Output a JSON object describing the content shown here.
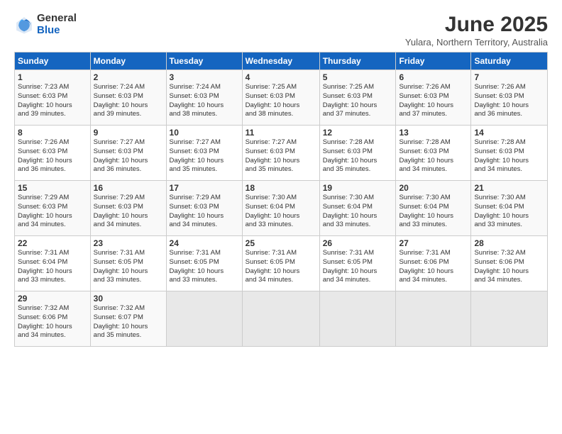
{
  "logo": {
    "general": "General",
    "blue": "Blue"
  },
  "title": "June 2025",
  "subtitle": "Yulara, Northern Territory, Australia",
  "weekdays": [
    "Sunday",
    "Monday",
    "Tuesday",
    "Wednesday",
    "Thursday",
    "Friday",
    "Saturday"
  ],
  "weeks": [
    [
      {
        "day": "1",
        "info": "Sunrise: 7:23 AM\nSunset: 6:03 PM\nDaylight: 10 hours\nand 39 minutes."
      },
      {
        "day": "2",
        "info": "Sunrise: 7:24 AM\nSunset: 6:03 PM\nDaylight: 10 hours\nand 39 minutes."
      },
      {
        "day": "3",
        "info": "Sunrise: 7:24 AM\nSunset: 6:03 PM\nDaylight: 10 hours\nand 38 minutes."
      },
      {
        "day": "4",
        "info": "Sunrise: 7:25 AM\nSunset: 6:03 PM\nDaylight: 10 hours\nand 38 minutes."
      },
      {
        "day": "5",
        "info": "Sunrise: 7:25 AM\nSunset: 6:03 PM\nDaylight: 10 hours\nand 37 minutes."
      },
      {
        "day": "6",
        "info": "Sunrise: 7:26 AM\nSunset: 6:03 PM\nDaylight: 10 hours\nand 37 minutes."
      },
      {
        "day": "7",
        "info": "Sunrise: 7:26 AM\nSunset: 6:03 PM\nDaylight: 10 hours\nand 36 minutes."
      }
    ],
    [
      {
        "day": "8",
        "info": "Sunrise: 7:26 AM\nSunset: 6:03 PM\nDaylight: 10 hours\nand 36 minutes."
      },
      {
        "day": "9",
        "info": "Sunrise: 7:27 AM\nSunset: 6:03 PM\nDaylight: 10 hours\nand 36 minutes."
      },
      {
        "day": "10",
        "info": "Sunrise: 7:27 AM\nSunset: 6:03 PM\nDaylight: 10 hours\nand 35 minutes."
      },
      {
        "day": "11",
        "info": "Sunrise: 7:27 AM\nSunset: 6:03 PM\nDaylight: 10 hours\nand 35 minutes."
      },
      {
        "day": "12",
        "info": "Sunrise: 7:28 AM\nSunset: 6:03 PM\nDaylight: 10 hours\nand 35 minutes."
      },
      {
        "day": "13",
        "info": "Sunrise: 7:28 AM\nSunset: 6:03 PM\nDaylight: 10 hours\nand 34 minutes."
      },
      {
        "day": "14",
        "info": "Sunrise: 7:28 AM\nSunset: 6:03 PM\nDaylight: 10 hours\nand 34 minutes."
      }
    ],
    [
      {
        "day": "15",
        "info": "Sunrise: 7:29 AM\nSunset: 6:03 PM\nDaylight: 10 hours\nand 34 minutes."
      },
      {
        "day": "16",
        "info": "Sunrise: 7:29 AM\nSunset: 6:03 PM\nDaylight: 10 hours\nand 34 minutes."
      },
      {
        "day": "17",
        "info": "Sunrise: 7:29 AM\nSunset: 6:03 PM\nDaylight: 10 hours\nand 34 minutes."
      },
      {
        "day": "18",
        "info": "Sunrise: 7:30 AM\nSunset: 6:04 PM\nDaylight: 10 hours\nand 33 minutes."
      },
      {
        "day": "19",
        "info": "Sunrise: 7:30 AM\nSunset: 6:04 PM\nDaylight: 10 hours\nand 33 minutes."
      },
      {
        "day": "20",
        "info": "Sunrise: 7:30 AM\nSunset: 6:04 PM\nDaylight: 10 hours\nand 33 minutes."
      },
      {
        "day": "21",
        "info": "Sunrise: 7:30 AM\nSunset: 6:04 PM\nDaylight: 10 hours\nand 33 minutes."
      }
    ],
    [
      {
        "day": "22",
        "info": "Sunrise: 7:31 AM\nSunset: 6:04 PM\nDaylight: 10 hours\nand 33 minutes."
      },
      {
        "day": "23",
        "info": "Sunrise: 7:31 AM\nSunset: 6:05 PM\nDaylight: 10 hours\nand 33 minutes."
      },
      {
        "day": "24",
        "info": "Sunrise: 7:31 AM\nSunset: 6:05 PM\nDaylight: 10 hours\nand 33 minutes."
      },
      {
        "day": "25",
        "info": "Sunrise: 7:31 AM\nSunset: 6:05 PM\nDaylight: 10 hours\nand 34 minutes."
      },
      {
        "day": "26",
        "info": "Sunrise: 7:31 AM\nSunset: 6:05 PM\nDaylight: 10 hours\nand 34 minutes."
      },
      {
        "day": "27",
        "info": "Sunrise: 7:31 AM\nSunset: 6:06 PM\nDaylight: 10 hours\nand 34 minutes."
      },
      {
        "day": "28",
        "info": "Sunrise: 7:32 AM\nSunset: 6:06 PM\nDaylight: 10 hours\nand 34 minutes."
      }
    ],
    [
      {
        "day": "29",
        "info": "Sunrise: 7:32 AM\nSunset: 6:06 PM\nDaylight: 10 hours\nand 34 minutes."
      },
      {
        "day": "30",
        "info": "Sunrise: 7:32 AM\nSunset: 6:07 PM\nDaylight: 10 hours\nand 35 minutes."
      },
      {
        "day": "",
        "info": ""
      },
      {
        "day": "",
        "info": ""
      },
      {
        "day": "",
        "info": ""
      },
      {
        "day": "",
        "info": ""
      },
      {
        "day": "",
        "info": ""
      }
    ]
  ]
}
